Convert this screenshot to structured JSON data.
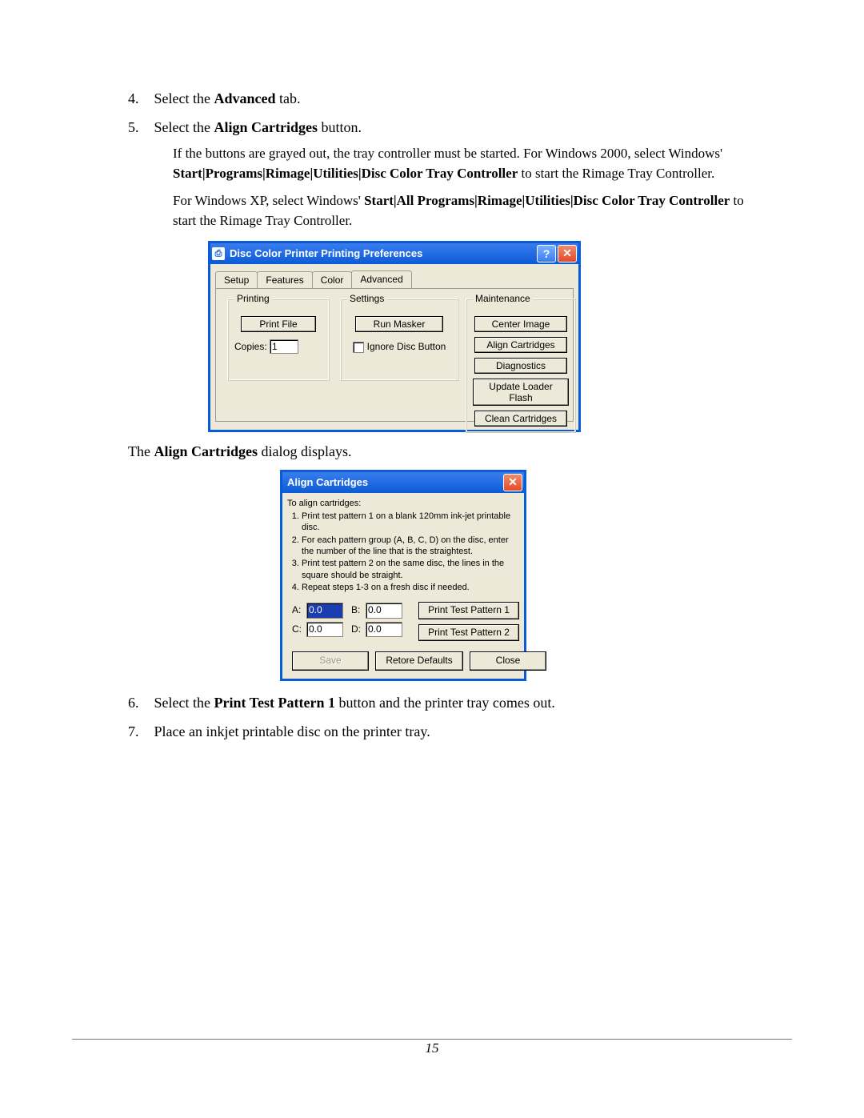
{
  "doc": {
    "step4_num": "4.",
    "step4_a": "Select the ",
    "step4_b": "Advanced",
    "step4_c": " tab.",
    "step5_num": "5.",
    "step5_a": "Select the ",
    "step5_b": "Align Cartridges",
    "step5_c": " button.",
    "p1_a": "If the buttons are grayed out, the tray controller must be started. For Windows 2000, select Windows' ",
    "p1_b": "Start|Programs|Rimage|Utilities|Disc Color Tray Controller",
    "p1_c": " to start the Rimage Tray Controller.",
    "p2_a": "For Windows XP, select Windows' ",
    "p2_b": "Start|All Programs|Rimage|Utilities|Disc Color Tray Controller",
    "p2_c": " to start the Rimage Tray Controller.",
    "mid_a": "The ",
    "mid_b": "Align Cartridges",
    "mid_c": " dialog displays.",
    "step6_num": "6.",
    "step6_a": "Select the ",
    "step6_b": "Print Test Pattern 1",
    "step6_c": " button and the printer tray comes out.",
    "step7_num": "7.",
    "step7_text": "Place an inkjet printable disc on the printer tray.",
    "page_number": "15"
  },
  "win1": {
    "title": "Disc Color Printer Printing Preferences",
    "tabs": {
      "setup": "Setup",
      "features": "Features",
      "color": "Color",
      "advanced": "Advanced"
    },
    "grp_printing": "Printing",
    "btn_print_file": "Print File",
    "copies_label": "Copies:",
    "copies_value": "1",
    "grp_settings": "Settings",
    "btn_run_masker": "Run Masker",
    "chk_ignore": "Ignore Disc Button",
    "grp_maint": "Maintenance",
    "btn_center": "Center Image",
    "btn_align": "Align Cartridges",
    "btn_diag": "Diagnostics",
    "btn_update": "Update Loader Flash",
    "btn_clean": "Clean Cartridges"
  },
  "win2": {
    "title": "Align Cartridges",
    "intro": "To align cartridges:",
    "li1": "Print test pattern 1 on a blank 120mm ink-jet printable disc.",
    "li2": "For each pattern group (A, B, C, D) on the disc, enter the number of the line that is the straightest.",
    "li3": "Print test pattern 2 on the same disc, the lines in the square should be straight.",
    "li4": "Repeat steps 1-3 on a fresh disc if needed.",
    "labA": "A:",
    "valA": "0.0",
    "labB": "B:",
    "valB": "0.0",
    "labC": "C:",
    "valC": "0.0",
    "labD": "D:",
    "valD": "0.0",
    "btn_p1": "Print Test Pattern 1",
    "btn_p2": "Print Test Pattern 2",
    "btn_save": "Save",
    "btn_restore": "Retore Defaults",
    "btn_close": "Close"
  }
}
